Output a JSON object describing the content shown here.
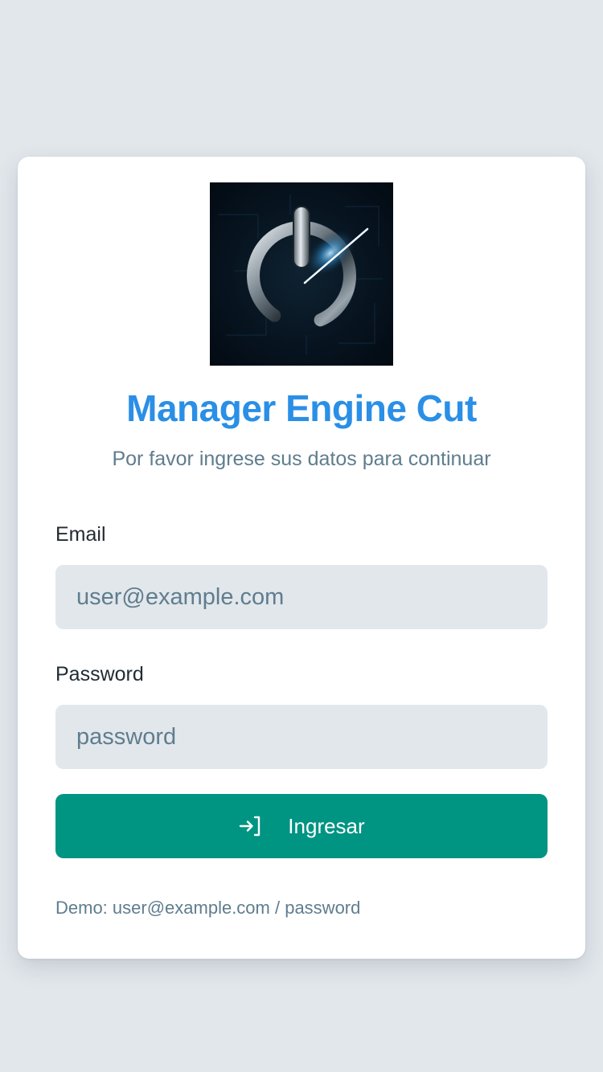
{
  "app": {
    "title": "Manager Engine Cut",
    "subtitle": "Por favor ingrese sus datos para continuar",
    "logo_icon": "power-button-icon"
  },
  "form": {
    "email_label": "Email",
    "email_placeholder": "user@example.com",
    "email_value": "",
    "password_label": "Password",
    "password_placeholder": "password",
    "password_value": "",
    "submit_label": "Ingresar",
    "submit_icon": "login-arrow-icon"
  },
  "demo_text": "Demo: user@example.com / password",
  "colors": {
    "background": "#e2e7ec",
    "card": "#ffffff",
    "title": "#2a8fe6",
    "muted_text": "#5f7d8e",
    "label_text": "#222c33",
    "input_bg": "#e2e7ec",
    "button_bg": "#009482",
    "button_text": "#ffffff"
  }
}
